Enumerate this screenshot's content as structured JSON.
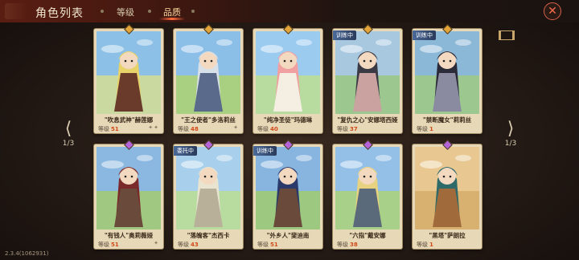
{
  "header": {
    "title": "角色列表",
    "tabs": [
      {
        "label": "等级"
      },
      {
        "label": "品质"
      }
    ],
    "close": "✕"
  },
  "nav": {
    "left_page": "1/3",
    "right_page": "1/3"
  },
  "version": "2.3.4(1062931)",
  "level_label": "等级",
  "colors": {
    "gold": "#e3a53a",
    "purple": "#b463d8",
    "level_number": "#d04a1a"
  },
  "cards": [
    {
      "name": "\"吹息武神\"赫莲娜",
      "level": "51",
      "stars": "✦✦",
      "gem": "gold",
      "badge": "",
      "palette": [
        "#8cc0e6",
        "#c9d9a0",
        "#e8d26a",
        "#6a3a2a"
      ]
    },
    {
      "name": "\"王之使者\"多洛莉丝",
      "level": "48",
      "stars": "✦",
      "gem": "gold",
      "badge": "",
      "palette": [
        "#8cbfe8",
        "#a8d080",
        "#d8e0e8",
        "#5a6a8a"
      ]
    },
    {
      "name": "\"纯净圣徒\"玛德琳",
      "level": "40",
      "stars": "",
      "gem": "gold",
      "badge": "",
      "palette": [
        "#9ccbf0",
        "#b8dca0",
        "#f0a0a0",
        "#f4efe2"
      ]
    },
    {
      "name": "\"复仇之心\"安娜塔西娅",
      "level": "37",
      "stars": "",
      "gem": "gold",
      "badge": "训练中",
      "palette": [
        "#a8c8e0",
        "#9cc890",
        "#3a3a44",
        "#caa2a0"
      ]
    },
    {
      "name": "\"禁断魔女\"莉莉丝",
      "level": "1",
      "stars": "",
      "gem": "gold",
      "badge": "训练中",
      "palette": [
        "#8cb8d8",
        "#9cc890",
        "#2a2a38",
        "#8a8aa0"
      ]
    },
    {
      "name": "\"有钱人\"奥莉薇娅",
      "level": "51",
      "stars": "✦",
      "gem": "purple",
      "badge": "",
      "palette": [
        "#8ab8e0",
        "#a0c880",
        "#7a2a2a",
        "#6a4a3a"
      ]
    },
    {
      "name": "\"落魄客\"杰西卡",
      "level": "43",
      "stars": "",
      "gem": "purple",
      "badge": "委托中",
      "palette": [
        "#a8d0ec",
        "#b8dca0",
        "#e8e4d0",
        "#b8b098"
      ]
    },
    {
      "name": "\"外乡人\"斐迪南",
      "level": "51",
      "stars": "",
      "gem": "purple",
      "badge": "训练中",
      "palette": [
        "#88b4e0",
        "#9cc880",
        "#2a3a6a",
        "#6a4a3a"
      ]
    },
    {
      "name": "\"六指\"戴安娜",
      "level": "38",
      "stars": "",
      "gem": "purple",
      "badge": "",
      "palette": [
        "#94c0e8",
        "#a8d088",
        "#e6d280",
        "#5a6a7a"
      ]
    },
    {
      "name": "\"黑塔\"萨朗拉",
      "level": "1",
      "stars": "",
      "gem": "purple",
      "badge": "",
      "palette": [
        "#e8c890",
        "#d8b070",
        "#2e6a6a",
        "#a06a3a"
      ]
    }
  ]
}
